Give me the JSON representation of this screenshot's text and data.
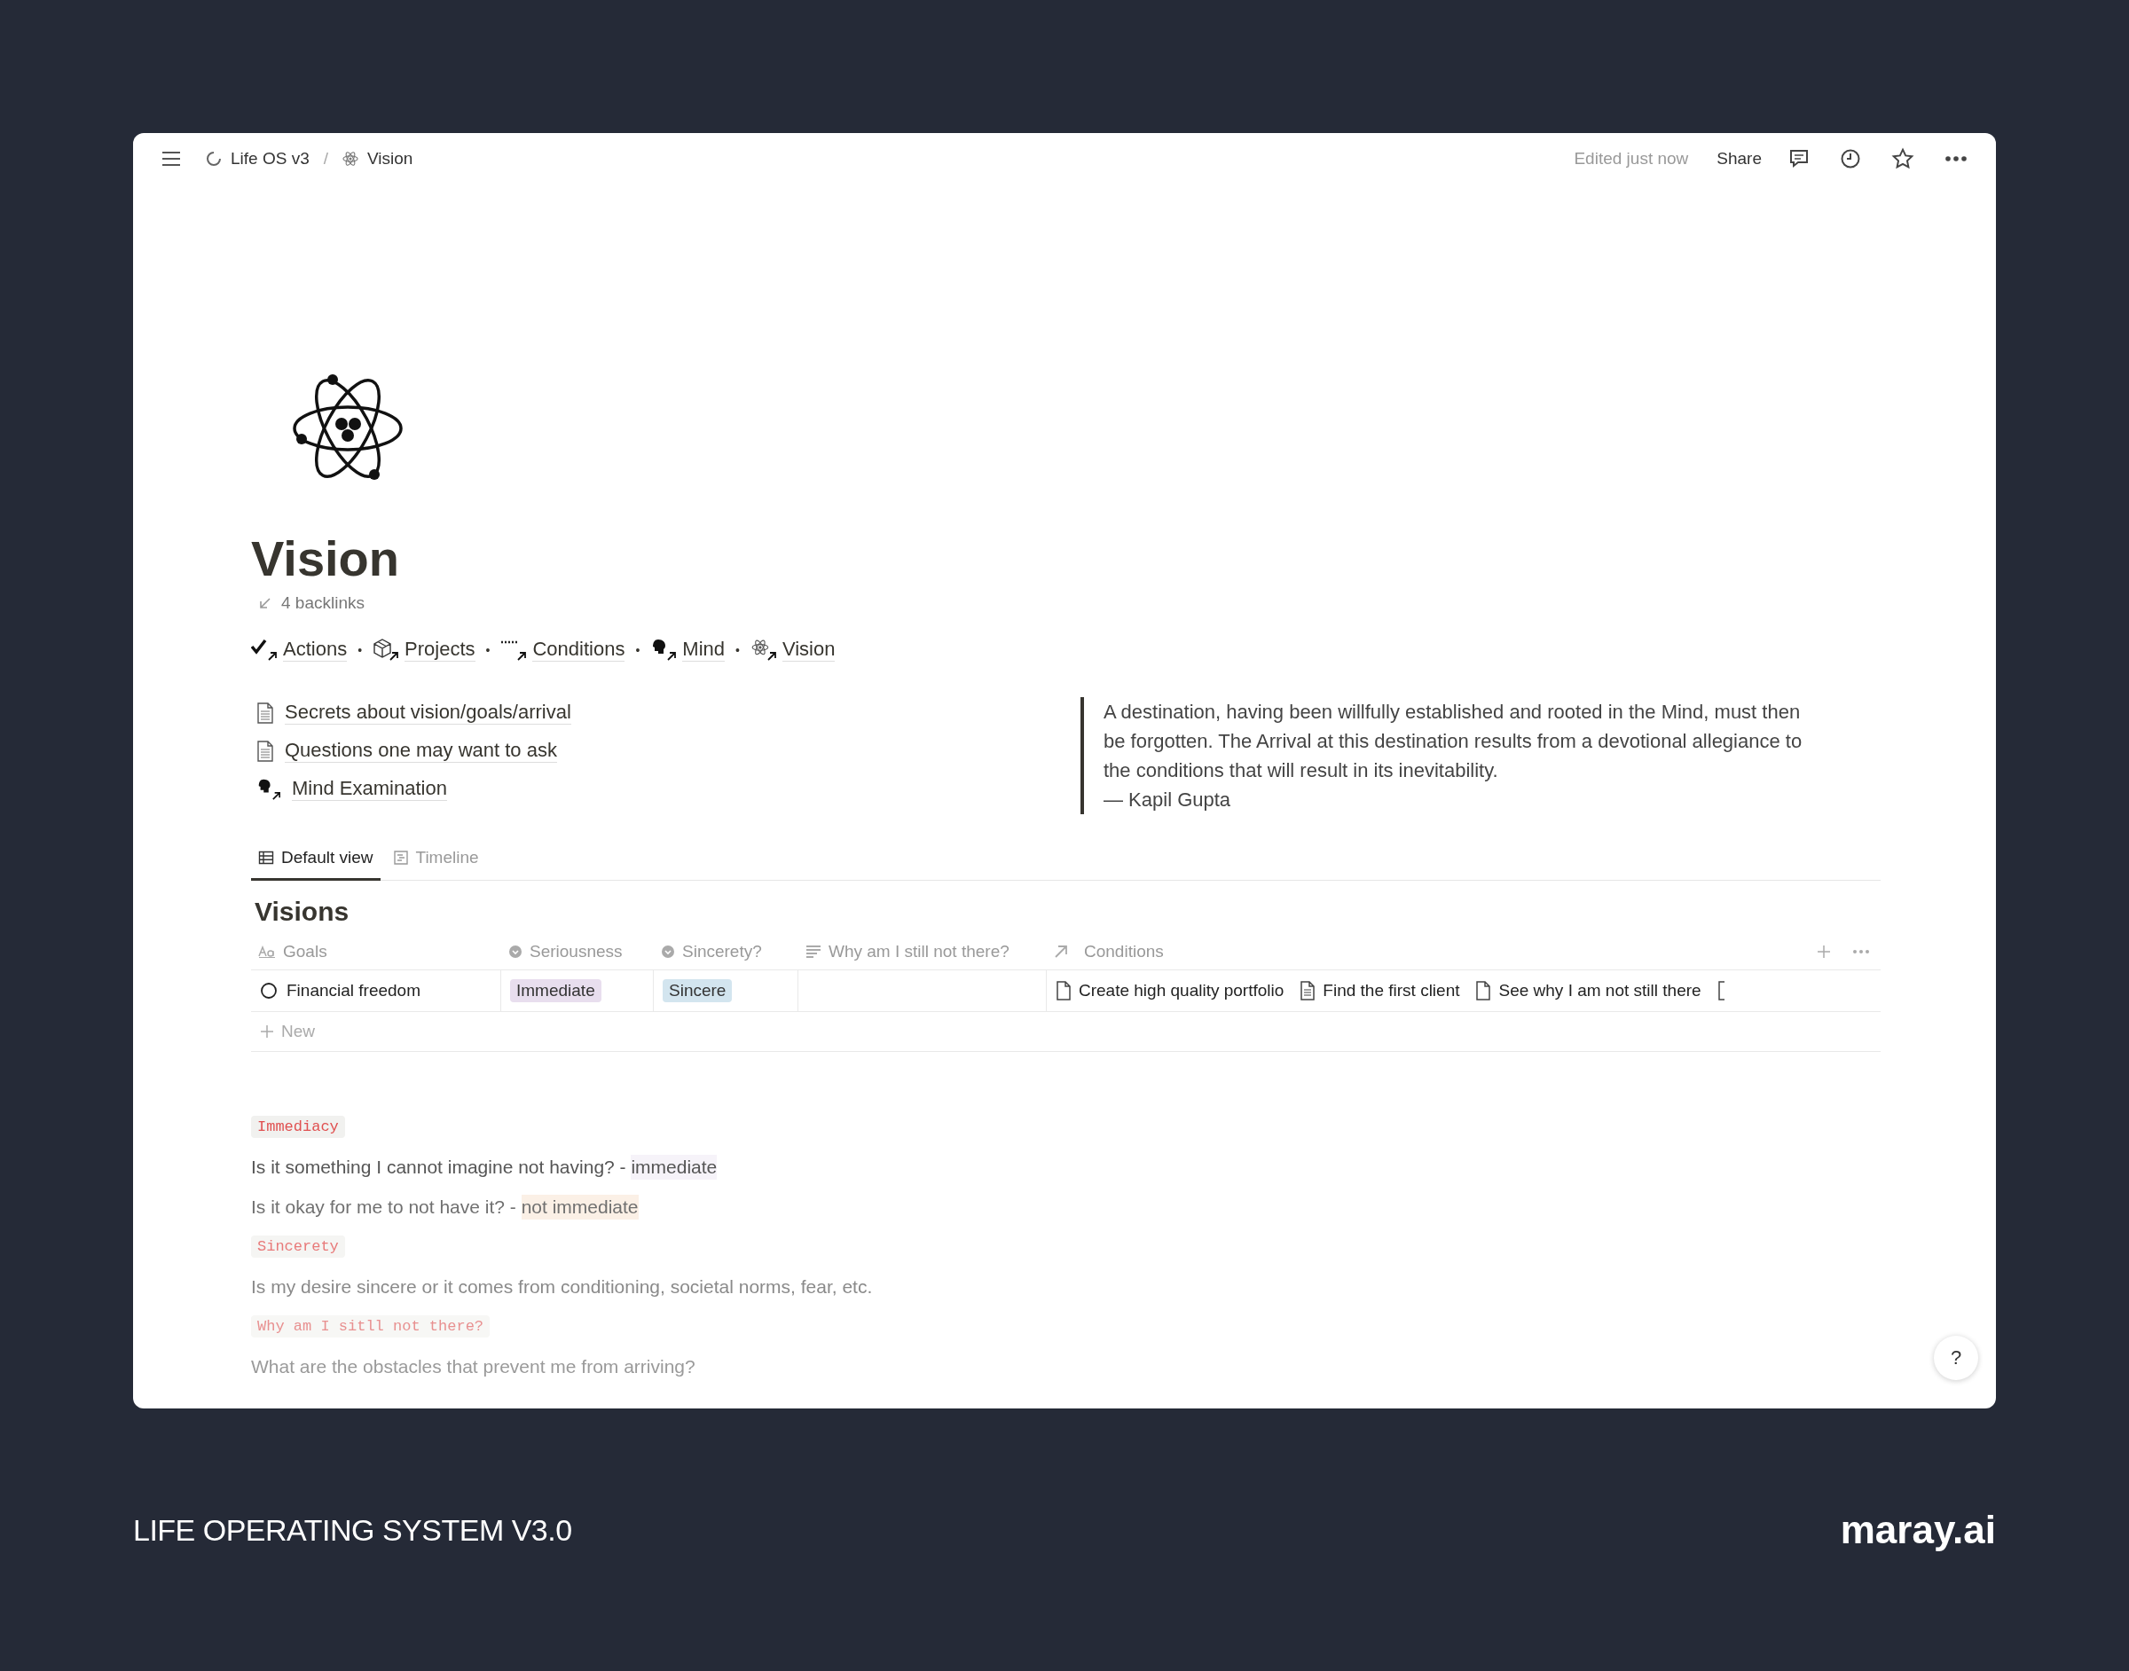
{
  "topbar": {
    "breadcrumbs": [
      {
        "label": "Life OS v3",
        "kind": "spinner"
      },
      {
        "label": "Vision",
        "kind": "atom"
      }
    ],
    "separator": "/",
    "edited": "Edited just now",
    "share": "Share"
  },
  "page": {
    "title": "Vision",
    "backlinks": "4 backlinks",
    "links": [
      {
        "label": "Actions",
        "kind": "check"
      },
      {
        "label": "Projects",
        "kind": "cube"
      },
      {
        "label": "Conditions",
        "kind": "dots"
      },
      {
        "label": "Mind",
        "kind": "head"
      },
      {
        "label": "Vision",
        "kind": "atom"
      }
    ],
    "link_separator": "•",
    "pages": [
      {
        "label": "Secrets about vision/goals/arrival",
        "kind": "doc"
      },
      {
        "label": "Questions one may want to ask",
        "kind": "doc"
      },
      {
        "label": "Mind Examination",
        "kind": "head"
      }
    ],
    "quote": {
      "text": "A destination, having been willfully established and rooted in the Mind, must then be forgotten. The Arrival at this destination results from a devotional allegiance to the conditions that will result in its inevitability.",
      "author": "— Kapil Gupta"
    }
  },
  "views": [
    {
      "label": "Default view",
      "kind": "table",
      "selected": true
    },
    {
      "label": "Timeline",
      "kind": "timeline",
      "selected": false
    }
  ],
  "database": {
    "title": "Visions",
    "columns": [
      {
        "label": "Goals",
        "kind": "title"
      },
      {
        "label": "Seriousness",
        "kind": "select"
      },
      {
        "label": "Sincerety?",
        "kind": "select"
      },
      {
        "label": "Why am I still not there?",
        "kind": "text"
      },
      {
        "label": "Conditions",
        "kind": "relation"
      }
    ],
    "rows": [
      {
        "goal": "Financial freedom",
        "seriousness": {
          "label": "Immediate",
          "color": "#e8deee"
        },
        "sincerity": {
          "label": "Sincere",
          "color": "#d3e5ef"
        },
        "conditions": [
          {
            "label": "Create high quality portfolio",
            "kind": "doc"
          },
          {
            "label": "Find the first client",
            "kind": "lines"
          },
          {
            "label": "See why I am not still there",
            "kind": "doc"
          }
        ]
      }
    ],
    "new_label": "New"
  },
  "notes": [
    {
      "kind": "tag",
      "text": "Immediacy"
    },
    {
      "kind": "line",
      "text": "Is it something I cannot imagine not having? - ",
      "highlight": {
        "text": "immediate",
        "color": "#f6f3f9"
      }
    },
    {
      "kind": "line",
      "text": "Is it okay for me to not have it? - ",
      "highlight": {
        "text": "not immediate",
        "color": "#fbf0e6"
      }
    },
    {
      "kind": "tag",
      "text": "Sincerety"
    },
    {
      "kind": "line",
      "text": "Is my desire sincere or it comes from conditioning, societal norms, fear, etc."
    },
    {
      "kind": "tag",
      "text": "Why am I sitll not there?"
    },
    {
      "kind": "line",
      "text": "What are the obstacles that prevent me from arriving?"
    }
  ],
  "help": "?",
  "footer": {
    "title": "LIFE OPERATING SYSTEM V3.0",
    "brand": "maray.ai"
  }
}
